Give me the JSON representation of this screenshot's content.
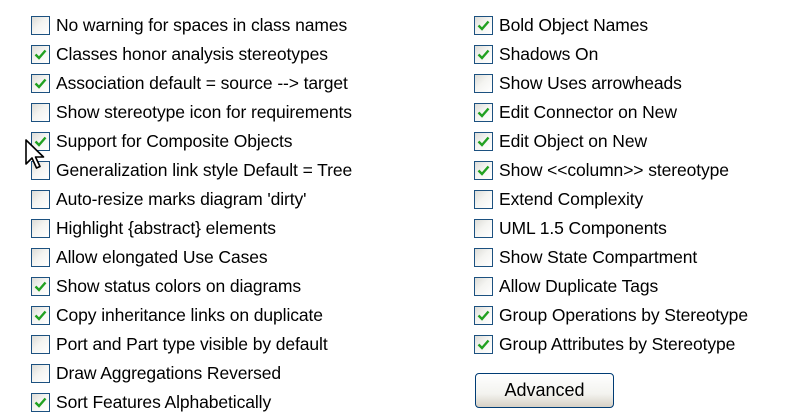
{
  "options_left": [
    {
      "label": "No warning for spaces in class names",
      "checked": false
    },
    {
      "label": "Classes honor analysis stereotypes",
      "checked": true
    },
    {
      "label": "Association default = source --> target",
      "checked": true
    },
    {
      "label": "Show stereotype icon for requirements",
      "checked": false
    },
    {
      "label": "Support for Composite Objects",
      "checked": true
    },
    {
      "label": "Generalization link style Default = Tree",
      "checked": false
    },
    {
      "label": "Auto-resize marks diagram 'dirty'",
      "checked": false
    },
    {
      "label": "Highlight {abstract} elements",
      "checked": false
    },
    {
      "label": "Allow elongated Use Cases",
      "checked": false
    },
    {
      "label": "Show status colors on diagrams",
      "checked": true
    },
    {
      "label": "Copy inheritance links on duplicate",
      "checked": true
    },
    {
      "label": "Port and Part type visible by default",
      "checked": false
    },
    {
      "label": "Draw Aggregations Reversed",
      "checked": false
    },
    {
      "label": "Sort Features Alphabetically",
      "checked": true
    }
  ],
  "options_right": [
    {
      "label": "Bold Object Names",
      "checked": true
    },
    {
      "label": "Shadows On",
      "checked": true
    },
    {
      "label": "Show Uses arrowheads",
      "checked": false
    },
    {
      "label": "Edit Connector on New",
      "checked": true
    },
    {
      "label": "Edit Object on New",
      "checked": true
    },
    {
      "label": "Show <<column>> stereotype",
      "checked": true
    },
    {
      "label": "Extend Complexity",
      "checked": false
    },
    {
      "label": "UML 1.5 Components",
      "checked": false
    },
    {
      "label": "Show State Compartment",
      "checked": false
    },
    {
      "label": "Allow Duplicate Tags",
      "checked": false
    },
    {
      "label": "Group Operations by Stereotype",
      "checked": true
    },
    {
      "label": "Group Attributes by Stereotype",
      "checked": true
    }
  ],
  "advanced_button": {
    "label": "Advanced"
  },
  "icons": {
    "check": "checkmark-icon",
    "cursor": "mouse-pointer-icon"
  },
  "colors": {
    "checkbox_border": "#1c5180",
    "checkmark": "#21a121",
    "button_border": "#003c74"
  }
}
